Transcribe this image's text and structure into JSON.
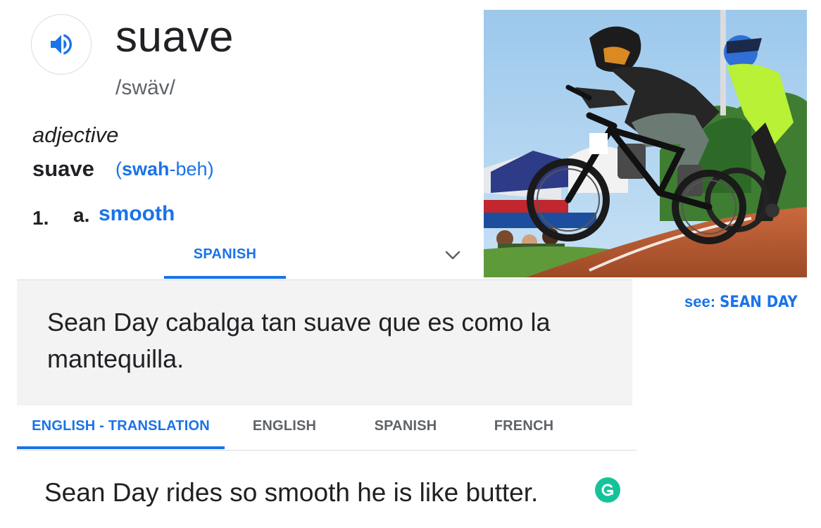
{
  "entry": {
    "word": "suave",
    "phonetic": "/swäv/",
    "part_of_speech": "adjective",
    "headword": "suave",
    "pronunciation": {
      "open": "(",
      "stressed": "swah",
      "rest": "-beh)"
    },
    "sense_number": "1.",
    "sense_letter": "a.",
    "sense_definition": "smooth"
  },
  "icons": {
    "speaker": "volume-icon",
    "chevron": "chevron-down-icon",
    "grammarly": "grammarly-icon"
  },
  "upper_tab": {
    "label": "SPANISH"
  },
  "example": {
    "text": "Sean Day cabalga tan suave que es como la mantequilla."
  },
  "lower_tabs": [
    {
      "label": "ENGLISH - TRANSLATION",
      "active": true
    },
    {
      "label": "ENGLISH",
      "active": false
    },
    {
      "label": "SPANISH",
      "active": false
    },
    {
      "label": "FRENCH",
      "active": false
    }
  ],
  "translation": {
    "text": "Sean Day rides so smooth he is like butter."
  },
  "see_also": {
    "prefix": "see:",
    "name": "SEAN DAY"
  },
  "colors": {
    "accent": "#1a73e8",
    "text": "#202124",
    "muted": "#5f6368",
    "panel": "#f3f3f3",
    "grammarly": "#15c39a"
  }
}
